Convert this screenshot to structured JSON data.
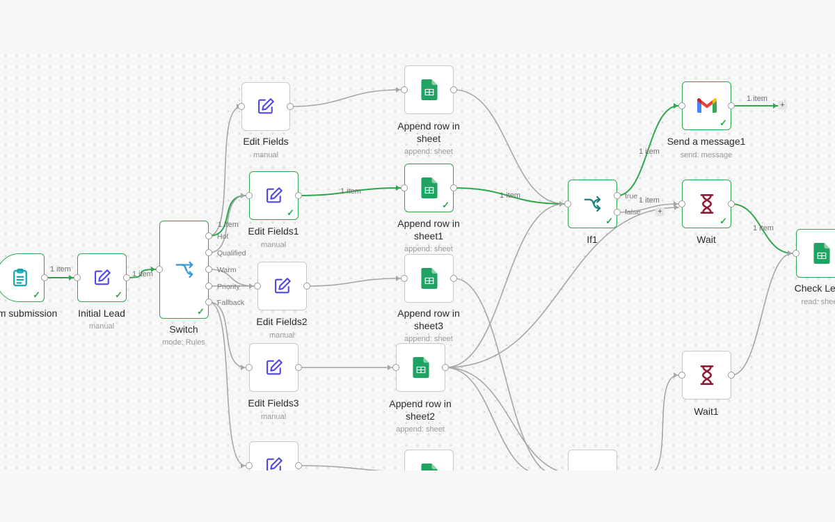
{
  "nodes": {
    "form_submission": {
      "title": "Form submission"
    },
    "initial_lead": {
      "title": "Initial Lead",
      "subtitle": "manual"
    },
    "switch": {
      "title": "Switch",
      "subtitle": "mode: Rules",
      "outputs": [
        "Hot",
        "Qualified",
        "Warm",
        "Priority",
        "Fallback"
      ]
    },
    "edit_fields": {
      "title": "Edit Fields",
      "subtitle": "manual"
    },
    "edit_fields1": {
      "title": "Edit Fields1",
      "subtitle": "manual"
    },
    "edit_fields2": {
      "title": "Edit Fields2",
      "subtitle": "manual"
    },
    "edit_fields3": {
      "title": "Edit Fields3",
      "subtitle": "manual"
    },
    "append_row": {
      "title_line1": "Append row in",
      "title_line2": "sheet",
      "subtitle": "append: sheet"
    },
    "append_row1": {
      "title_line1": "Append row in",
      "title_line2": "sheet1",
      "subtitle": "append: sheet"
    },
    "append_row3": {
      "title_line1": "Append row in",
      "title_line2": "sheet3",
      "subtitle": "append: sheet"
    },
    "append_row2": {
      "title_line1": "Append row in",
      "title_line2": "sheet2",
      "subtitle": "append: sheet"
    },
    "if1": {
      "title": "If1",
      "outputs": [
        "true",
        "false"
      ]
    },
    "send_message1": {
      "title": "Send a message1",
      "subtitle": "send: message"
    },
    "wait": {
      "title": "Wait"
    },
    "wait1": {
      "title": "Wait1"
    },
    "check_lead": {
      "title": "Check Lead",
      "subtitle": "read: sheet"
    }
  },
  "edge_labels": {
    "form_to_initial": "1 item",
    "initial_to_switch": "1 item",
    "switch_hot": "1 item",
    "edit1_to_append1": "1 item",
    "append1_to_if": "1 item",
    "if_true": "1 item",
    "if_false": "1 item",
    "send_out": "1 item",
    "wait_to_check": "1 item"
  },
  "colors": {
    "success": "#2aa84a",
    "edge": "#a6a6a6",
    "edit_icon": "#4f46e5",
    "sheets_icon": "#1ea362",
    "wait_icon": "#8b1d3a",
    "if_icon": "#1a7f7a",
    "switch_icon": "#3d9bd6"
  }
}
